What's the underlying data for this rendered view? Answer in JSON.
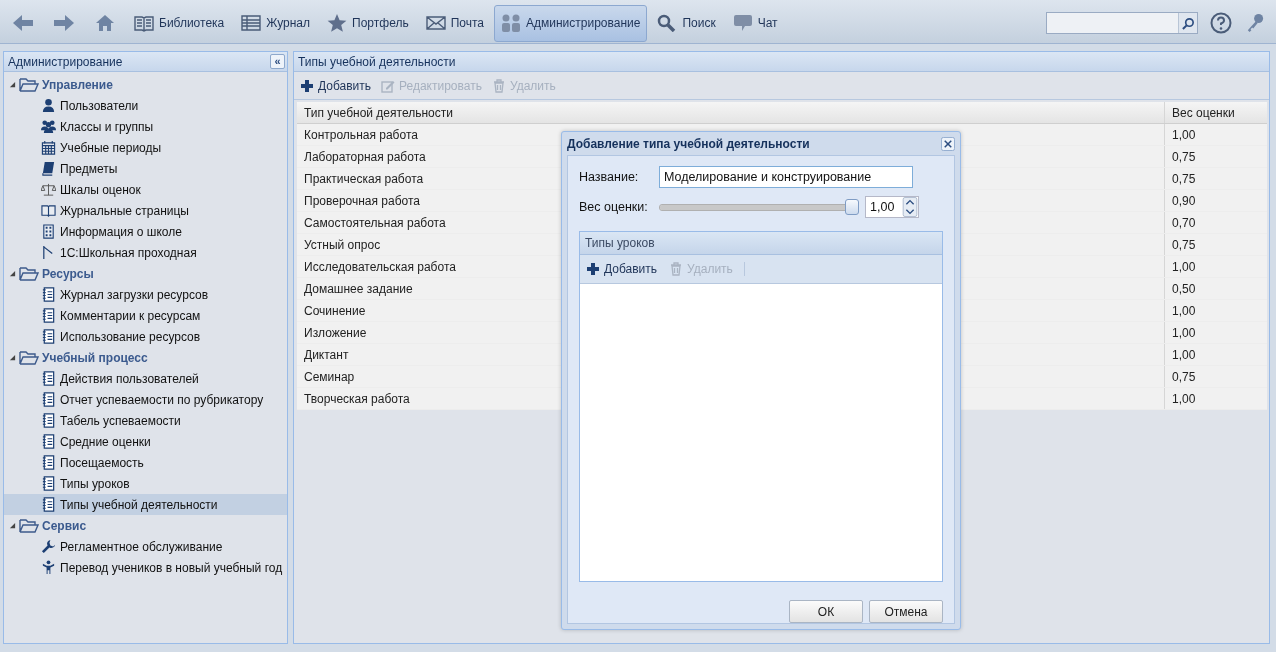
{
  "nav": [
    {
      "kind": "back",
      "selected": false
    },
    {
      "kind": "forward",
      "selected": false
    },
    {
      "kind": "home",
      "selected": false
    },
    {
      "kind": "book",
      "label": "Библиотека",
      "selected": false
    },
    {
      "kind": "journal",
      "label": "Журнал",
      "selected": false
    },
    {
      "kind": "star",
      "label": "Портфель",
      "selected": false
    },
    {
      "kind": "mail",
      "label": "Почта",
      "selected": false
    },
    {
      "kind": "admin",
      "label": "Администрирование",
      "selected": true
    },
    {
      "kind": "search",
      "label": "Поиск",
      "selected": false
    },
    {
      "kind": "chat",
      "label": "Чат",
      "selected": false
    }
  ],
  "sidebar": {
    "title": "Администрирование",
    "collapse_icon": "«",
    "groups": [
      {
        "label": "Управление",
        "expanded": true,
        "items": [
          {
            "label": "Пользователи",
            "selected": false
          },
          {
            "label": "Классы и группы",
            "selected": false
          },
          {
            "label": "Учебные периоды",
            "selected": false
          },
          {
            "label": "Предметы",
            "selected": false
          },
          {
            "label": "Шкалы оценок",
            "selected": false
          },
          {
            "label": "Журнальные страницы",
            "selected": false
          },
          {
            "label": "Информация о школе",
            "selected": false
          },
          {
            "label": "1С:Школьная проходная",
            "selected": false
          }
        ]
      },
      {
        "label": "Ресурсы",
        "expanded": true,
        "items": [
          {
            "label": "Журнал загрузки ресурсов",
            "selected": false
          },
          {
            "label": "Комментарии к ресурсам",
            "selected": false
          },
          {
            "label": "Использование ресурсов",
            "selected": false
          }
        ]
      },
      {
        "label": "Учебный процесс",
        "expanded": true,
        "items": [
          {
            "label": "Действия пользователей",
            "selected": false
          },
          {
            "label": "Отчет успеваемости по рубрикатору",
            "selected": false
          },
          {
            "label": "Табель успеваемости",
            "selected": false
          },
          {
            "label": "Средние оценки",
            "selected": false
          },
          {
            "label": "Посещаемость",
            "selected": false
          },
          {
            "label": "Типы уроков",
            "selected": false
          },
          {
            "label": "Типы учебной деятельности",
            "selected": true
          }
        ]
      },
      {
        "label": "Сервис",
        "expanded": true,
        "items": [
          {
            "label": "Регламентное обслуживание",
            "selected": false
          },
          {
            "label": "Перевод учеников в новый учебный год",
            "selected": false
          }
        ]
      }
    ]
  },
  "main": {
    "title": "Типы учебной деятельности",
    "toolbar": [
      {
        "kind": "add",
        "label": "Добавить",
        "disabled": false
      },
      {
        "kind": "edit",
        "label": "Редактировать",
        "disabled": true
      },
      {
        "kind": "delete",
        "label": "Удалить",
        "disabled": true
      }
    ],
    "columns": [
      "Тип учебной деятельности",
      "Вес оценки"
    ],
    "rows": [
      [
        "Контрольная работа",
        "1,00"
      ],
      [
        "Лабораторная работа",
        "0,75"
      ],
      [
        "Практическая работа",
        "0,75"
      ],
      [
        "Проверочная работа",
        "0,90"
      ],
      [
        "Самостоятельная работа",
        "0,70"
      ],
      [
        "Устный опрос",
        "0,75"
      ],
      [
        "Исследовательская работа",
        "1,00"
      ],
      [
        "Домашнее задание",
        "0,50"
      ],
      [
        "Сочинение",
        "1,00"
      ],
      [
        "Изложение",
        "1,00"
      ],
      [
        "Диктант",
        "1,00"
      ],
      [
        "Семинар",
        "0,75"
      ],
      [
        "Творческая работа",
        "1,00"
      ]
    ]
  },
  "dialog": {
    "title": "Добавление типа учебной деятельности",
    "name_label": "Название:",
    "name_value": "Моделирование и конструирование",
    "weight_label": "Вес оценки:",
    "weight": {
      "level": 1.0,
      "value": "1,00"
    },
    "lesson_types": {
      "title": "Типы уроков",
      "toolbar": [
        {
          "kind": "add",
          "label": "Добавить",
          "disabled": false
        },
        {
          "kind": "delete",
          "label": "Удалить",
          "disabled": true
        }
      ]
    },
    "buttons": [
      "ОК",
      "Отмена"
    ]
  }
}
